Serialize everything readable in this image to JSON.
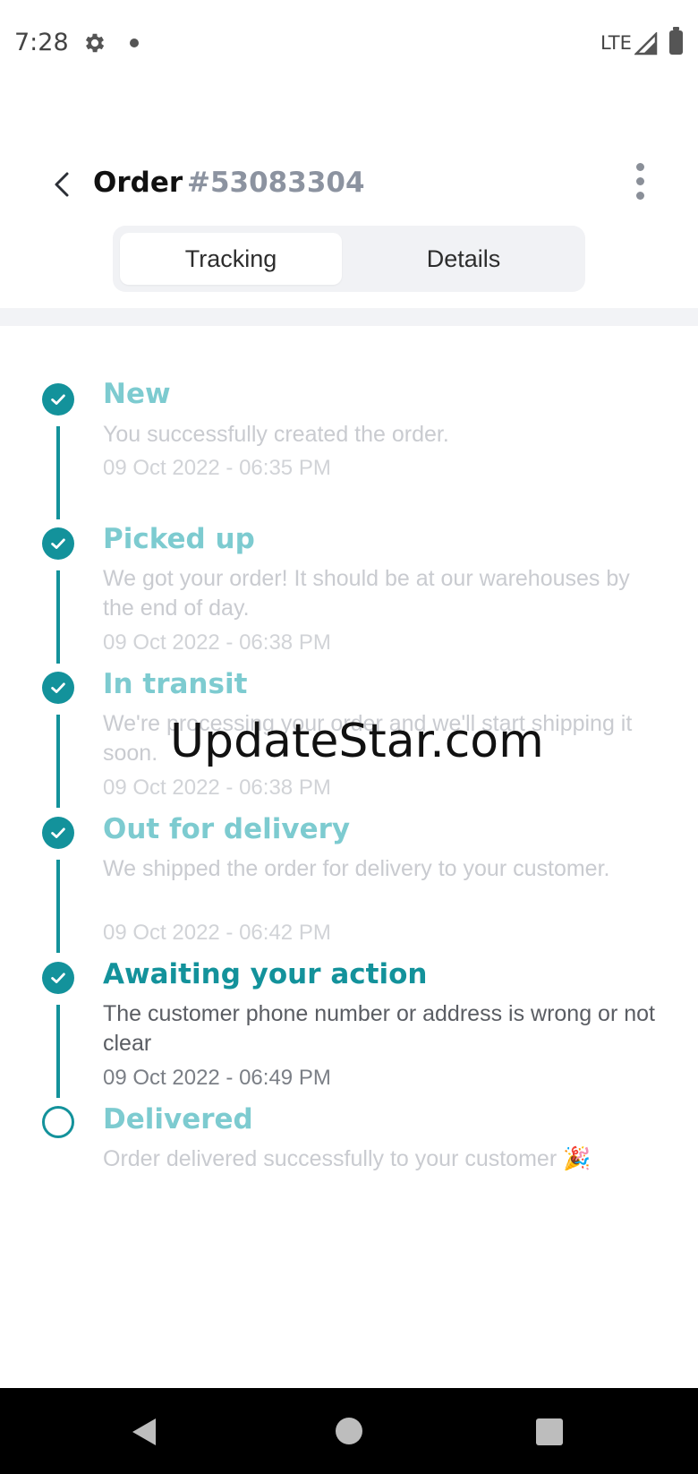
{
  "status_bar": {
    "time": "7:28",
    "network": "LTE",
    "icons": [
      "gear-icon",
      "notification-dot-icon",
      "signal-icon",
      "battery-icon"
    ]
  },
  "header": {
    "order_label": "Order",
    "order_number": "#53083304",
    "back_icon": "chevron-left-icon",
    "menu_icon": "more-vertical-icon"
  },
  "tabs": {
    "tracking": "Tracking",
    "details": "Details",
    "selected": "Tracking"
  },
  "timeline": [
    {
      "title": "New",
      "description": "You successfully created the order.",
      "timestamp": "09 Oct 2022 - 06:35 PM",
      "status": "completed"
    },
    {
      "title": "Picked up",
      "description": "We got your order! It should be at our warehouses by the end of day.",
      "timestamp": "09 Oct 2022 - 06:38 PM",
      "status": "completed"
    },
    {
      "title": "In transit",
      "description": "We're processing your order and we'll start shipping it soon.",
      "timestamp": "09 Oct 2022 - 06:38 PM",
      "status": "completed"
    },
    {
      "title": "Out for delivery",
      "description": "We shipped the order for delivery to your customer.",
      "timestamp": "09 Oct 2022 - 06:42 PM",
      "status": "completed"
    },
    {
      "title": "Awaiting your action",
      "description": "The customer phone number or address is wrong or not clear",
      "timestamp": "09 Oct 2022 - 06:49 PM",
      "status": "current"
    },
    {
      "title": "Delivered",
      "description": "Order delivered successfully to your customer 🎉",
      "timestamp": "",
      "status": "pending"
    }
  ],
  "watermark": "UpdateStar.com",
  "colors": {
    "accent": "#13929b",
    "accent_light": "#7dcbd0",
    "muted_text": "#c9cbd0",
    "tab_bg": "#f1f2f5"
  }
}
